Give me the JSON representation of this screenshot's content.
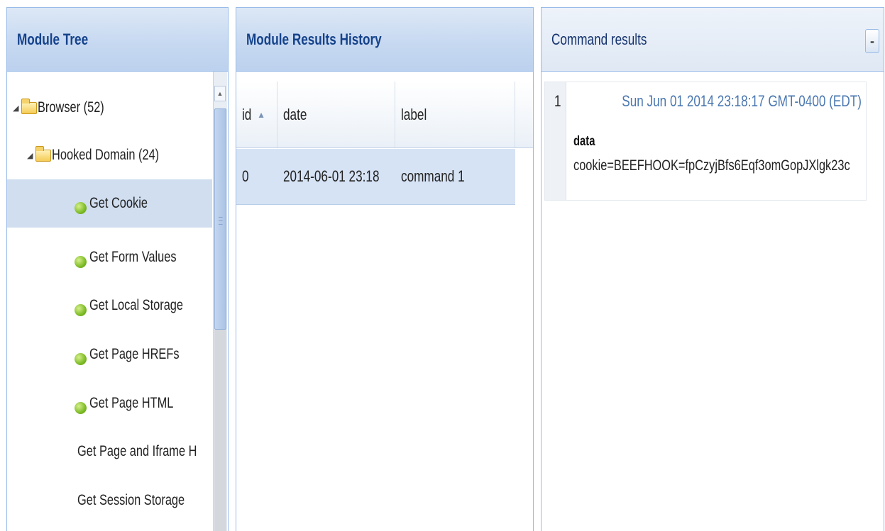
{
  "module_tree": {
    "title": "Module Tree",
    "items": [
      {
        "label": "Browser (52)",
        "type": "folder",
        "depth": 0,
        "expanded": true
      },
      {
        "label": "Hooked Domain (24)",
        "type": "folder",
        "depth": 1,
        "expanded": true
      },
      {
        "label": "Get Cookie",
        "type": "leaf",
        "depth": 2,
        "selected": true
      },
      {
        "label": "Get Form Values",
        "type": "leaf",
        "depth": 2
      },
      {
        "label": "Get Local Storage",
        "type": "leaf",
        "depth": 2
      },
      {
        "label": "Get Page HREFs",
        "type": "leaf",
        "depth": 2
      },
      {
        "label": "Get Page HTML",
        "type": "leaf",
        "depth": 2
      },
      {
        "label": "Get Page and Iframe H",
        "type": "leaf",
        "depth": 2
      },
      {
        "label": "Get Session Storage",
        "type": "leaf",
        "depth": 2
      }
    ]
  },
  "module_results_history": {
    "title": "Module Results History",
    "columns": [
      "id",
      "date",
      "label"
    ],
    "rows": [
      {
        "id": "0",
        "date": "2014-06-01 23:18",
        "label": "command 1"
      }
    ]
  },
  "command_results": {
    "title": "Command results",
    "collapse_symbol": "-",
    "entries": [
      {
        "number": "1",
        "timestamp": "Sun Jun 01 2014 23:18:17 GMT-0400 (EDT)",
        "key": "data",
        "value": "cookie=BEEFHOOK=fpCzyjBfs6Eqf3omGopJXlgk23c"
      }
    ]
  },
  "colors": {
    "header_title": "#15428b",
    "selection": "#d0def0",
    "border": "#99bbe8",
    "timestamp": "#4a77b0"
  }
}
